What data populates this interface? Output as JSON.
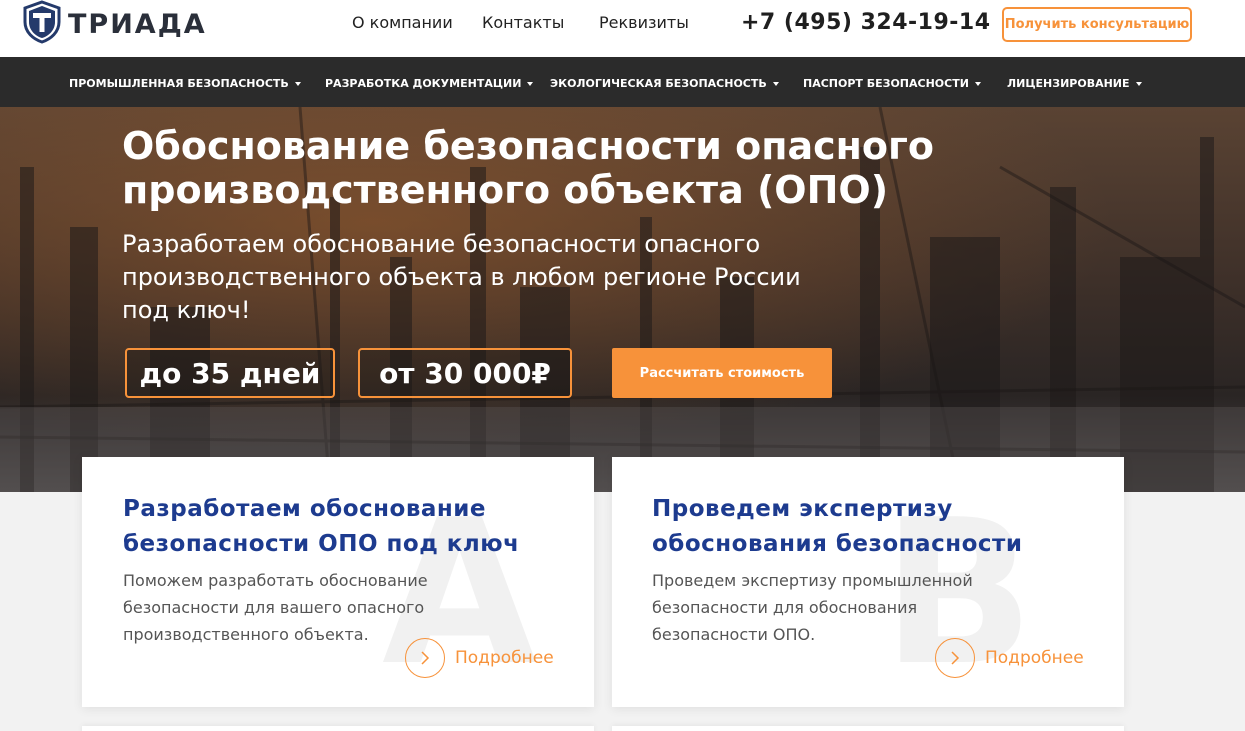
{
  "header": {
    "logo_text": "ТРИАДА",
    "logo_icon": "shield-t-icon",
    "nav": [
      "О компании",
      "Контакты",
      "Реквизиты"
    ],
    "phone": "+7 (495) 324-19-14",
    "consult_label": "Получить консультацию"
  },
  "menu": {
    "items": [
      "ПРОМЫШЛЕННАЯ БЕЗОПАСНОСТЬ",
      "РАЗРАБОТКА ДОКУМЕНТАЦИИ",
      "ЭКОЛОГИЧЕСКАЯ БЕЗОПАСНОСТЬ",
      "ПАСПОРТ БЕЗОПАСНОСТИ",
      "ЛИЦЕНЗИРОВАНИЕ"
    ]
  },
  "hero": {
    "title": "Обоснование безопасности опасного производственного объекта (ОПО)",
    "subtitle": "Разработаем обоснование безопасности опасного производственного объекта в любом регионе России под ключ!",
    "badge_days": "до 35 дней",
    "badge_price": "от 30 000₽",
    "calc_label": "Рассчитать стоимость"
  },
  "cards": [
    {
      "letter": "А",
      "title": "Разработаем обоснование безопасности ОПО под ключ",
      "text": "Поможем разработать обоснование безопасности для вашего опасного производственного объекта.",
      "more": "Подробнее"
    },
    {
      "letter": "В",
      "title": "Проведем экспертизу обоснования безопасности",
      "text": "Проведем экспертизу промышленной безопасности для обоснования безопасности ОПО.",
      "more": "Подробнее"
    }
  ],
  "colors": {
    "accent": "#f7923a",
    "brand_blue": "#1d3b8f",
    "menu_bg": "#2b2b2b"
  }
}
